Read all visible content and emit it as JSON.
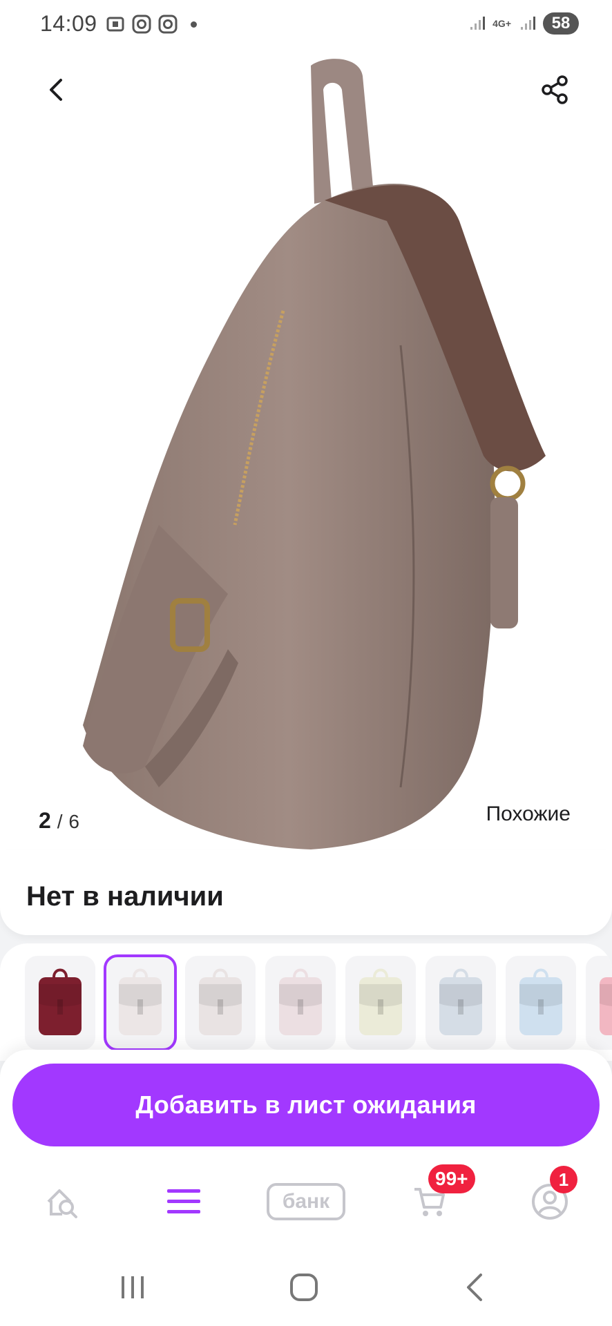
{
  "status_bar": {
    "time": "14:09",
    "network": "4G+",
    "battery": "58"
  },
  "gallery": {
    "current": "2",
    "separator": "/",
    "total": "6",
    "similar_label": "Похожие"
  },
  "availability": {
    "text": "Нет в наличии"
  },
  "variants": {
    "colors": [
      "#7d1f2e",
      "#ece6e6",
      "#e9e3e3",
      "#ecdfe2",
      "#ebebd8",
      "#d5dde6",
      "#cfe0ef",
      "#f2b7c2"
    ],
    "selected_index": 1
  },
  "cta": {
    "label": "Добавить в лист ожидания",
    "color": "#a238ff"
  },
  "bottom_nav": {
    "bank_label": "банк",
    "cart_badge": "99+",
    "profile_badge": "1"
  },
  "colors": {
    "accent": "#a238ff",
    "badge": "#f0213f"
  },
  "icons": {
    "back": "chevron-left-icon",
    "share": "share-icon",
    "home": "home-search-icon",
    "catalog": "menu-icon",
    "cart": "cart-icon",
    "profile": "profile-icon"
  }
}
